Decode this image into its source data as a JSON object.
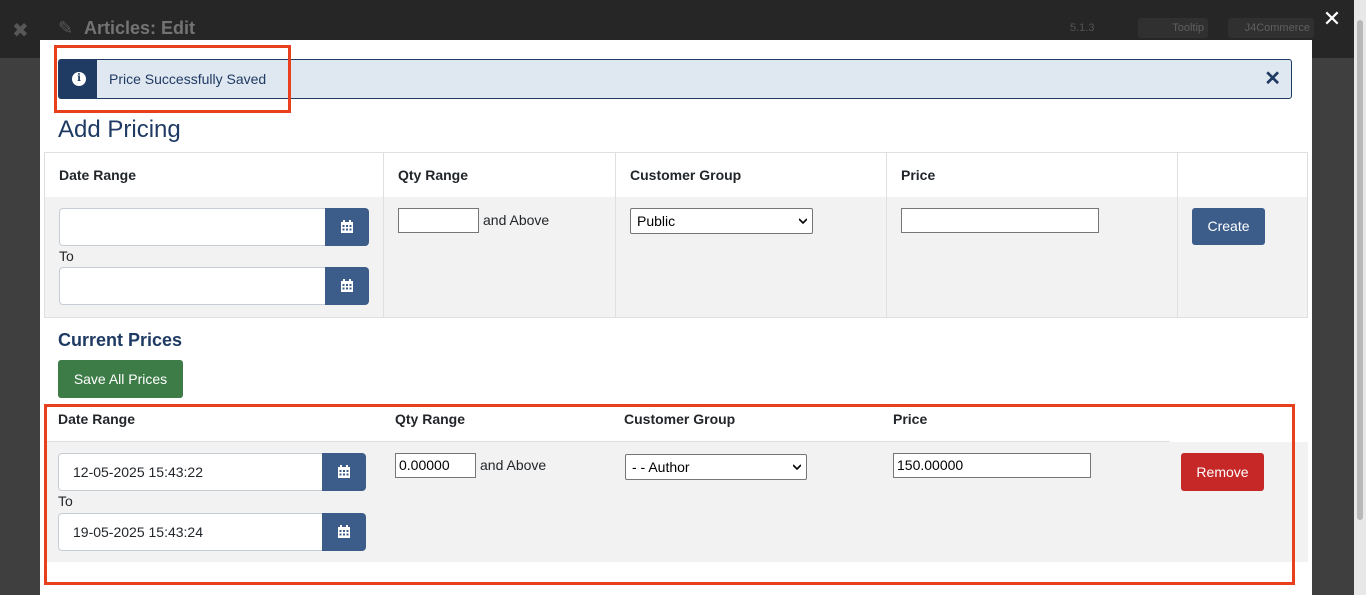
{
  "background": {
    "header_title": "Articles: Edit",
    "version": "5.1.3",
    "btn1": "Tooltip",
    "btn2": "J4Commerce"
  },
  "alert": {
    "message": "Price Successfully Saved"
  },
  "add_pricing": {
    "title": "Add Pricing",
    "headers": {
      "date_range": "Date Range",
      "qty_range": "Qty Range",
      "customer_group": "Customer Group",
      "price": "Price"
    },
    "from_date": "",
    "to_label": "To",
    "to_date": "",
    "qty": "",
    "and_above": "and Above",
    "customer_group": "Public",
    "price": "",
    "create_label": "Create"
  },
  "current_prices": {
    "title": "Current Prices",
    "save_all_label": "Save All Prices",
    "headers": {
      "date_range": "Date Range",
      "qty_range": "Qty Range",
      "customer_group": "Customer Group",
      "price": "Price"
    },
    "rows": [
      {
        "from_date": "12-05-2025 15:43:22",
        "to_label": "To",
        "to_date": "19-05-2025 15:43:24",
        "qty": "0.00000",
        "and_above": "and Above",
        "customer_group": "- - Author",
        "price": "150.00000",
        "remove_label": "Remove"
      }
    ]
  },
  "colors": {
    "primary": "#3c5c8a",
    "success": "#3d7c47",
    "danger": "#c52827",
    "highlight": "#e8401c",
    "alert_bg": "#dfe7f0"
  }
}
